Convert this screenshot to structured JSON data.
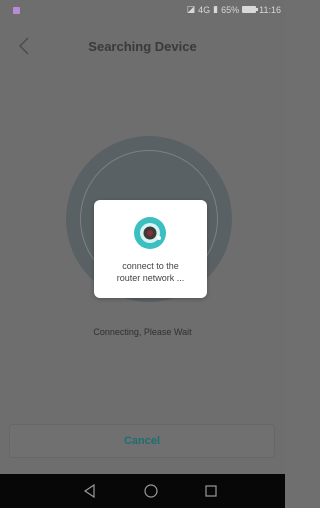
{
  "status": {
    "indicators": "⓿ 4G ℑ 65%",
    "network": "4G",
    "battery": "65%",
    "time": "11:16"
  },
  "header": {
    "title": "Searching Device"
  },
  "main": {
    "connecting_label": "Connecting, Please Wait"
  },
  "dialog": {
    "message": "connect to the\nrouter network ..."
  },
  "footer": {
    "cancel_label": "Cancel"
  },
  "colors": {
    "accent": "#1f6e6f",
    "camera_teal": "#3bbfc0",
    "overlay": "#6e6e6e"
  }
}
